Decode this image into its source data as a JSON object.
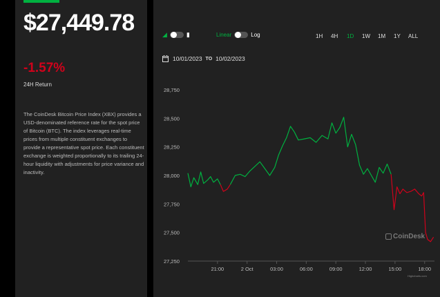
{
  "left": {
    "price": "$27,449.78",
    "change": "-1.57%",
    "return_label": "24H Return",
    "description": "The CoinDesk Bitcoin Price Index (XBX) provides a USD-denominated reference rate for the spot price of Bitcoin (BTC). The index leverages real-time prices from multiple constituent exchanges to provide a representative spot price. Each constituent exchange is weighted proportionally to its trailing 24-hour liquidity with adjustments for price variance and inactivity."
  },
  "controls": {
    "scale_linear": "Linear",
    "scale_log": "Log",
    "timeframes": [
      "1H",
      "4H",
      "1D",
      "1W",
      "1M",
      "1Y",
      "ALL"
    ],
    "active_timeframe": "1D",
    "date_from": "10/01/2023",
    "date_to_sep": "TO",
    "date_to": "10/02/2023"
  },
  "branding": {
    "logo": "CoinDesk",
    "credit": "Highcharts.com"
  },
  "colors": {
    "up": "#00b140",
    "down": "#d0021b",
    "panel": "#212121"
  },
  "chart_data": {
    "type": "line",
    "y_ticks": [
      "28,750",
      "28,500",
      "28,250",
      "28,000",
      "27,750",
      "27,500",
      "27,250"
    ],
    "y_tick_values": [
      28750,
      28500,
      28250,
      28000,
      27750,
      27500,
      27250
    ],
    "ylim": [
      27250,
      28750
    ],
    "x_ticks": [
      "21:00",
      "2 Oct",
      "03:00",
      "06:00",
      "09:00",
      "12:00",
      "15:00",
      "18:00"
    ],
    "x_tick_hours": [
      21,
      24,
      27,
      30,
      33,
      36,
      39,
      42
    ],
    "xlim_hours": [
      18,
      43
    ],
    "series": [
      {
        "color": "#00b140",
        "x": [
          18,
          18.3,
          18.6,
          19,
          19.3,
          19.6,
          20,
          20.3,
          20.6,
          21,
          21.3
        ],
        "y": [
          28020,
          27900,
          27980,
          27920,
          28030,
          27930,
          27960,
          27990,
          27940,
          27970,
          27920
        ]
      },
      {
        "color": "#d0021b",
        "x": [
          21.3,
          21.6,
          22,
          22.3
        ],
        "y": [
          27920,
          27860,
          27880,
          27920
        ]
      },
      {
        "color": "#00b140",
        "x": [
          22.3,
          22.8,
          23.3,
          23.8,
          24.3,
          24.8,
          25.3,
          25.8,
          26.3,
          26.8,
          27.2,
          27.6,
          28,
          28.4,
          28.8,
          29.2,
          29.8,
          30.4,
          31,
          31.6,
          32.2,
          32.6,
          33,
          33.4,
          33.8,
          34.2,
          34.6,
          35,
          35.4,
          35.8,
          36.2,
          36.6,
          37,
          37.4,
          37.8,
          38.2,
          38.6
        ],
        "y": [
          27920,
          28000,
          28010,
          27990,
          28040,
          28080,
          28120,
          28060,
          28000,
          28070,
          28180,
          28260,
          28330,
          28430,
          28380,
          28310,
          28320,
          28330,
          28290,
          28350,
          28320,
          28460,
          28370,
          28420,
          28510,
          28250,
          28360,
          28270,
          28090,
          28010,
          28060,
          28000,
          27940,
          28070,
          28020,
          28100,
          28010
        ]
      },
      {
        "color": "#d0021b",
        "x": [
          38.6,
          38.9,
          39.2,
          39.5,
          39.8,
          40.2,
          40.6,
          41,
          41.4,
          41.7,
          41.9,
          42.1,
          42.3,
          42.6,
          42.9
        ],
        "y": [
          28010,
          27700,
          27900,
          27840,
          27880,
          27850,
          27860,
          27880,
          27840,
          27820,
          27850,
          27500,
          27440,
          27420,
          27460
        ]
      }
    ]
  }
}
